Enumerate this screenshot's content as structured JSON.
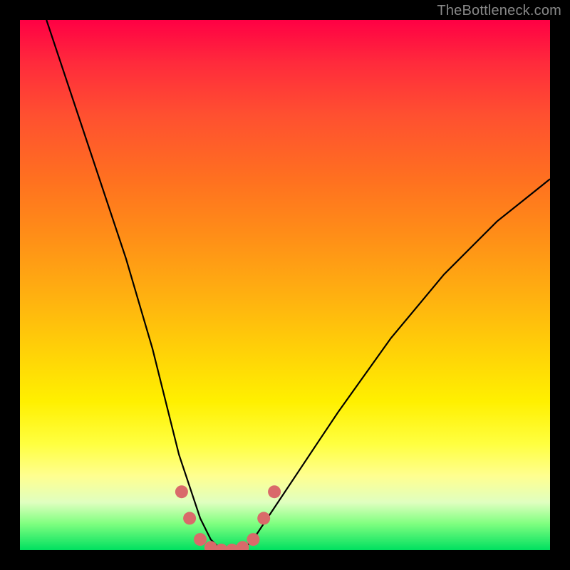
{
  "watermark": "TheBottleneck.com",
  "chart_data": {
    "type": "line",
    "title": "",
    "xlabel": "",
    "ylabel": "",
    "xlim": [
      0,
      100
    ],
    "ylim": [
      0,
      100
    ],
    "series": [
      {
        "name": "bottleneck-curve",
        "x": [
          5,
          10,
          15,
          20,
          25,
          28,
          30,
          32,
          34,
          36,
          38,
          40,
          42,
          44,
          48,
          52,
          56,
          60,
          65,
          70,
          75,
          80,
          85,
          90,
          95,
          100
        ],
        "y": [
          100,
          85,
          70,
          55,
          38,
          26,
          18,
          12,
          6,
          2,
          0,
          0,
          0,
          2,
          8,
          14,
          20,
          26,
          33,
          40,
          46,
          52,
          57,
          62,
          66,
          70
        ]
      }
    ],
    "markers": {
      "name": "highlight-points",
      "x": [
        30.5,
        32,
        34,
        36,
        38,
        40,
        42,
        44,
        46,
        48
      ],
      "y": [
        11,
        6,
        2,
        0.5,
        0,
        0,
        0.5,
        2,
        6,
        11
      ]
    },
    "gradient_stops": [
      {
        "pos": 0,
        "color": "#ff0044"
      },
      {
        "pos": 50,
        "color": "#ffb000"
      },
      {
        "pos": 80,
        "color": "#ffff40"
      },
      {
        "pos": 100,
        "color": "#00e060"
      }
    ]
  }
}
